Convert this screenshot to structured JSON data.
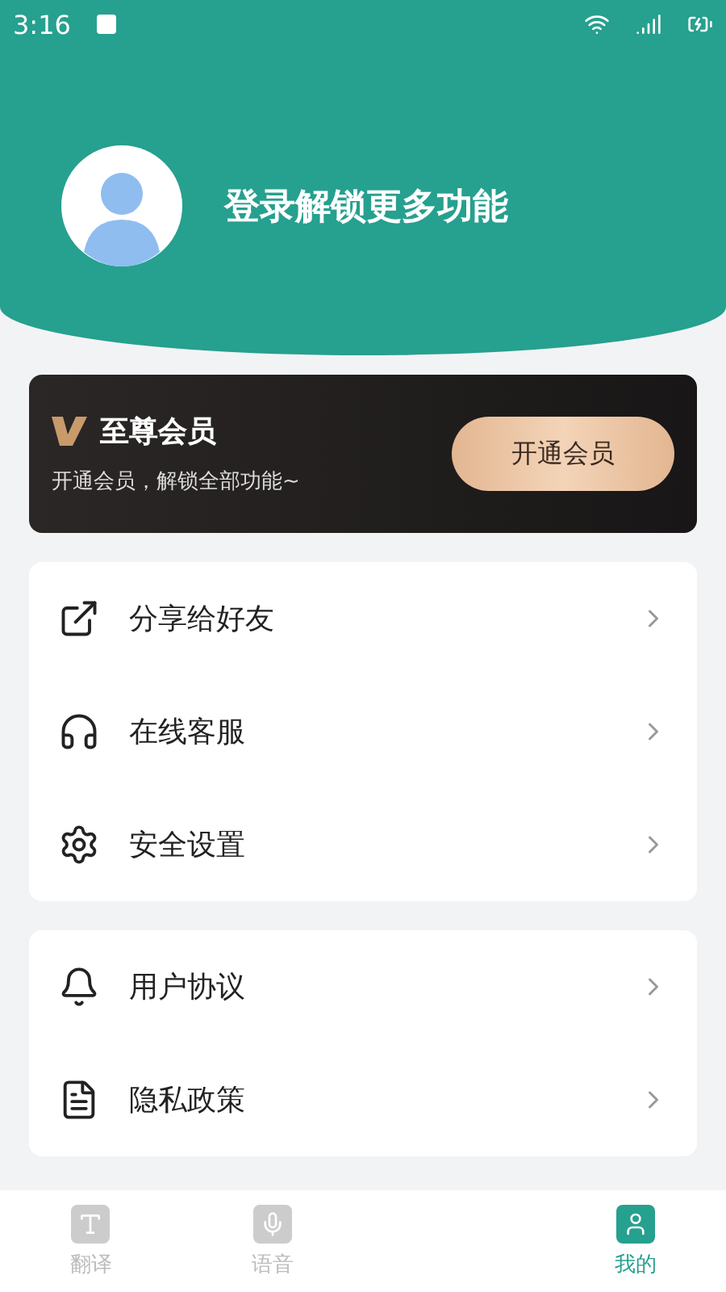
{
  "status_bar": {
    "time": "3:16"
  },
  "profile": {
    "login_prompt": "登录解锁更多功能"
  },
  "vip_card": {
    "title": "至尊会员",
    "subtitle": "开通会员，解锁全部功能~",
    "button": "开通会员"
  },
  "menu_groups": [
    {
      "items": [
        {
          "kind": "share",
          "label": "分享给好友"
        },
        {
          "kind": "support",
          "label": "在线客服"
        },
        {
          "kind": "security",
          "label": "安全设置"
        }
      ]
    },
    {
      "items": [
        {
          "kind": "agreement",
          "label": "用户协议"
        },
        {
          "kind": "privacy",
          "label": "隐私政策"
        }
      ]
    }
  ],
  "bottom_nav": [
    {
      "kind": "translate",
      "label": "翻译",
      "selected": false
    },
    {
      "kind": "voice",
      "label": "语音",
      "selected": false
    },
    {
      "kind": "blank"
    },
    {
      "kind": "me",
      "label": "我的",
      "selected": true
    }
  ]
}
